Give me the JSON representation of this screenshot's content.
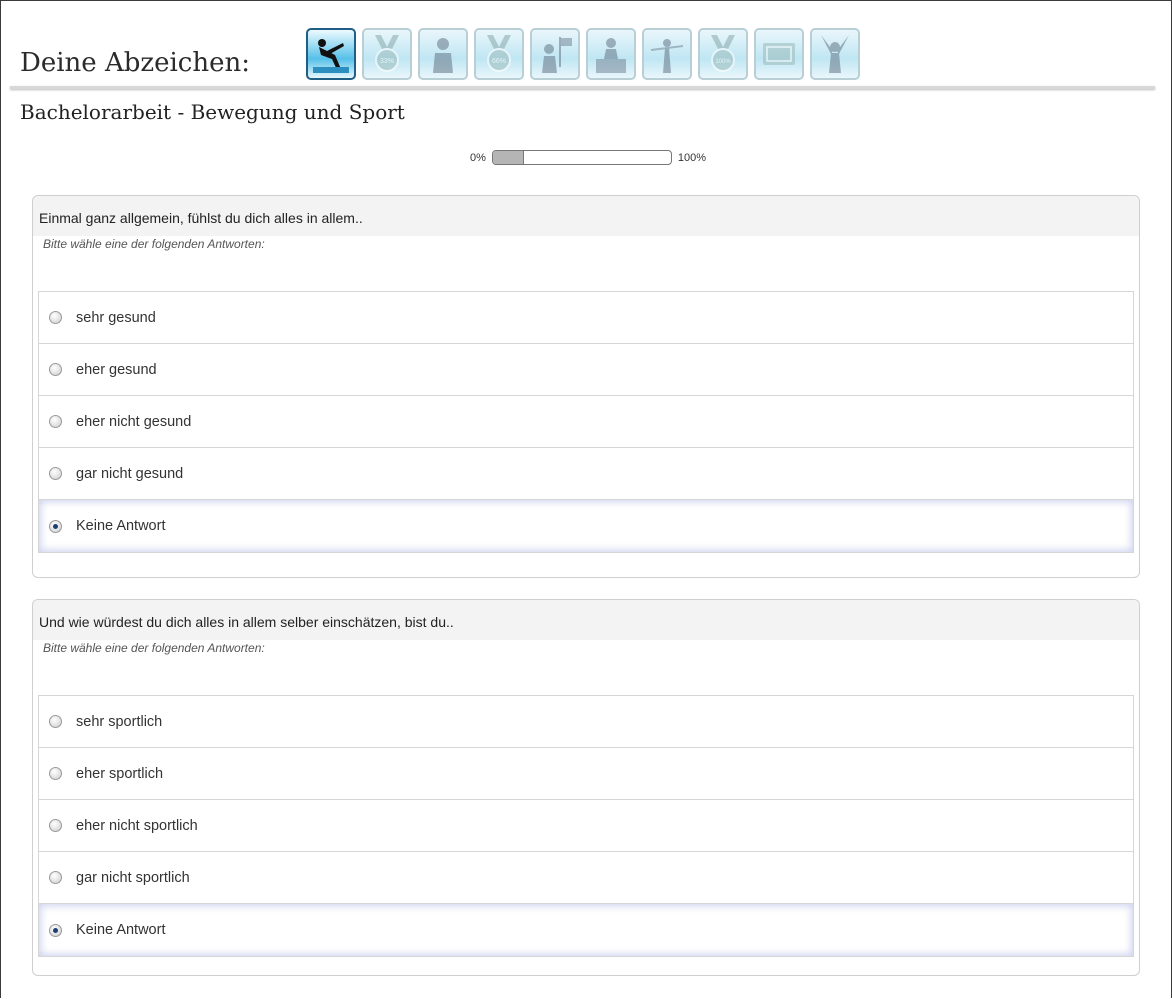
{
  "badges": {
    "title": "Deine Abzeichen:",
    "items": [
      {
        "icon": "swimmer-icon",
        "active": true
      },
      {
        "icon": "medal-33-icon",
        "label": "33%",
        "active": false
      },
      {
        "icon": "person-icon",
        "active": false
      },
      {
        "icon": "medal-66-icon",
        "label": "66%",
        "active": false
      },
      {
        "icon": "flag-person-icon",
        "active": false
      },
      {
        "icon": "podium-icon",
        "active": false
      },
      {
        "icon": "finish-line-icon",
        "active": false
      },
      {
        "icon": "medal-100-icon",
        "label": "100%",
        "active": false
      },
      {
        "icon": "ticket-icon",
        "active": false
      },
      {
        "icon": "cheering-icon",
        "active": false
      }
    ]
  },
  "survey": {
    "title": "Bachelorarbeit - Bewegung und Sport",
    "progress": {
      "min_label": "0%",
      "max_label": "100%",
      "value": 0.17
    }
  },
  "questions": [
    {
      "text": "Einmal ganz allgemein, fühlst du dich alles in allem..",
      "help": "Bitte wähle eine der folgenden Antworten:",
      "answers": [
        {
          "label": "sehr gesund",
          "selected": false
        },
        {
          "label": "eher gesund",
          "selected": false
        },
        {
          "label": "eher nicht gesund",
          "selected": false
        },
        {
          "label": "gar nicht gesund",
          "selected": false
        },
        {
          "label": "Keine Antwort",
          "selected": true
        }
      ]
    },
    {
      "text": "Und wie würdest du dich alles in allem selber einschätzen, bist du..",
      "help": "Bitte wähle eine der folgenden Antworten:",
      "answers": [
        {
          "label": "sehr sportlich",
          "selected": false
        },
        {
          "label": "eher sportlich",
          "selected": false
        },
        {
          "label": "eher nicht sportlich",
          "selected": false
        },
        {
          "label": "gar nicht sportlich",
          "selected": false
        },
        {
          "label": "Keine Antwort",
          "selected": true
        }
      ]
    }
  ]
}
